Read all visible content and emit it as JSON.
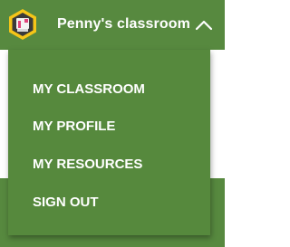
{
  "header": {
    "classroom_name": "Penny's classroom",
    "avatar_icon": "classroom-avatar-icon",
    "toggle_icon": "chevron-up-icon"
  },
  "menu": {
    "items": [
      {
        "label": "MY CLASSROOM"
      },
      {
        "label": "MY PROFILE"
      },
      {
        "label": "MY RESOURCES"
      },
      {
        "label": "SIGN OUT"
      }
    ]
  },
  "colors": {
    "header_bg": "#57893f",
    "menu_bg": "#56893d",
    "text": "#ffffff",
    "avatar_ring": "#f5c518"
  }
}
